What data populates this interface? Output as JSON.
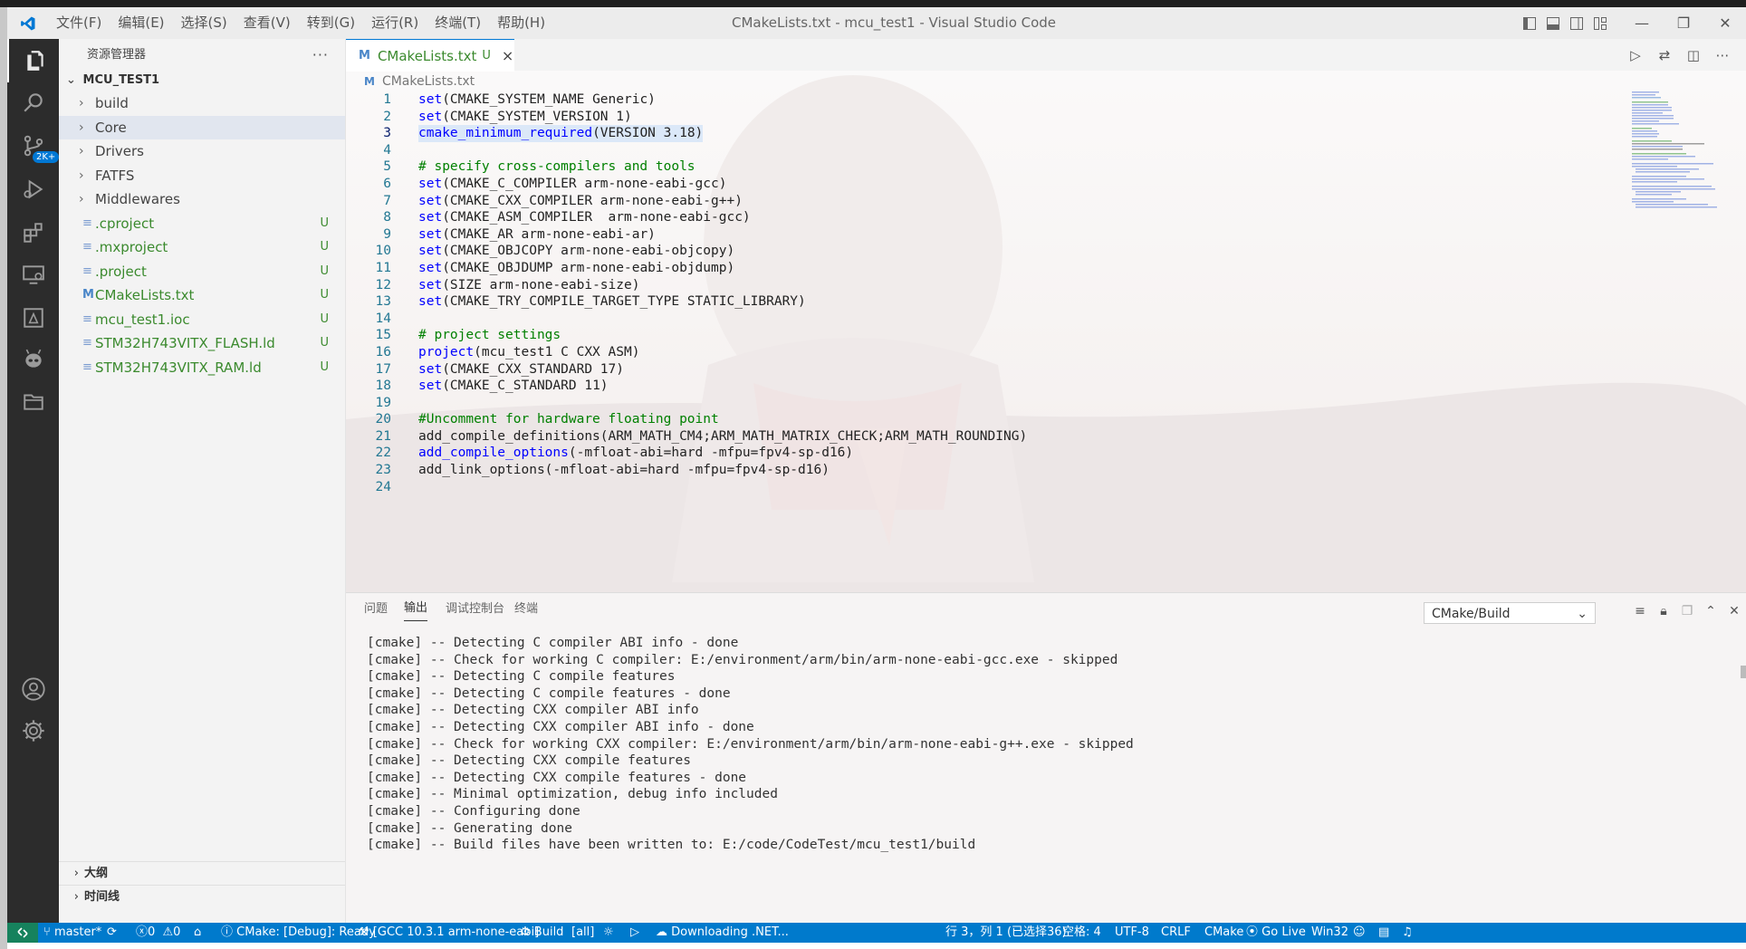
{
  "window": {
    "title": "CMakeLists.txt - mcu_test1 - Visual Studio Code",
    "menu": [
      "文件(F)",
      "编辑(E)",
      "选择(S)",
      "查看(V)",
      "转到(G)",
      "运行(R)",
      "终端(T)",
      "帮助(H)"
    ]
  },
  "activity_bar": {
    "source_control_badge": "2K+"
  },
  "sidebar": {
    "title": "资源管理器",
    "more": "···",
    "root": "MCU_TEST1",
    "items": [
      {
        "label": "build",
        "type": "folder",
        "badge": ""
      },
      {
        "label": "Core",
        "type": "folder",
        "badge": ""
      },
      {
        "label": "Drivers",
        "type": "folder",
        "badge": ""
      },
      {
        "label": "FATFS",
        "type": "folder",
        "badge": ""
      },
      {
        "label": "Middlewares",
        "type": "folder",
        "badge": ""
      },
      {
        "label": ".cproject",
        "type": "file",
        "badge": "U"
      },
      {
        "label": ".mxproject",
        "type": "file",
        "badge": "U"
      },
      {
        "label": ".project",
        "type": "file",
        "badge": "U"
      },
      {
        "label": "CMakeLists.txt",
        "type": "file",
        "badge": "U"
      },
      {
        "label": "mcu_test1.ioc",
        "type": "file",
        "badge": "U"
      },
      {
        "label": "STM32H743VITX_FLASH.ld",
        "type": "file",
        "badge": "U"
      },
      {
        "label": "STM32H743VITX_RAM.ld",
        "type": "file",
        "badge": "U"
      }
    ],
    "outline": "大纲",
    "timeline": "时间线"
  },
  "editor": {
    "tab": {
      "icon": "M",
      "name": "CMakeLists.txt",
      "status": "U",
      "close": "×"
    },
    "breadcrumb": {
      "icon": "M",
      "file": "CMakeLists.txt"
    },
    "lines": [
      {
        "n": "1",
        "kw": "set",
        "rest": "(CMAKE_SYSTEM_NAME Generic)",
        "comment": ""
      },
      {
        "n": "2",
        "kw": "set",
        "rest": "(CMAKE_SYSTEM_VERSION 1)",
        "comment": ""
      },
      {
        "n": "3",
        "kw": "cmake_minimum_required",
        "rest": "(VERSION 3.18)",
        "comment": ""
      },
      {
        "n": "4",
        "kw": "",
        "rest": "",
        "comment": ""
      },
      {
        "n": "5",
        "kw": "",
        "rest": "",
        "comment": "# specify cross-compilers and tools"
      },
      {
        "n": "6",
        "kw": "set",
        "rest": "(CMAKE_C_COMPILER arm-none-eabi-gcc)",
        "comment": ""
      },
      {
        "n": "7",
        "kw": "set",
        "rest": "(CMAKE_CXX_COMPILER arm-none-eabi-g++)",
        "comment": ""
      },
      {
        "n": "8",
        "kw": "set",
        "rest": "(CMAKE_ASM_COMPILER  arm-none-eabi-gcc)",
        "comment": ""
      },
      {
        "n": "9",
        "kw": "set",
        "rest": "(CMAKE_AR arm-none-eabi-ar)",
        "comment": ""
      },
      {
        "n": "10",
        "kw": "set",
        "rest": "(CMAKE_OBJCOPY arm-none-eabi-objcopy)",
        "comment": ""
      },
      {
        "n": "11",
        "kw": "set",
        "rest": "(CMAKE_OBJDUMP arm-none-eabi-objdump)",
        "comment": ""
      },
      {
        "n": "12",
        "kw": "set",
        "rest": "(SIZE arm-none-eabi-size)",
        "comment": ""
      },
      {
        "n": "13",
        "kw": "set",
        "rest": "(CMAKE_TRY_COMPILE_TARGET_TYPE STATIC_LIBRARY)",
        "comment": ""
      },
      {
        "n": "14",
        "kw": "",
        "rest": "",
        "comment": ""
      },
      {
        "n": "15",
        "kw": "",
        "rest": "",
        "comment": "# project settings"
      },
      {
        "n": "16",
        "kw": "project",
        "rest": "(mcu_test1 C CXX ASM)",
        "comment": ""
      },
      {
        "n": "17",
        "kw": "set",
        "rest": "(CMAKE_CXX_STANDARD 17)",
        "comment": ""
      },
      {
        "n": "18",
        "kw": "set",
        "rest": "(CMAKE_C_STANDARD 11)",
        "comment": ""
      },
      {
        "n": "19",
        "kw": "",
        "rest": "",
        "comment": ""
      },
      {
        "n": "20",
        "kw": "",
        "rest": "",
        "comment": "#Uncomment for hardware floating point"
      },
      {
        "n": "21",
        "kw": "",
        "rest": "add_compile_definitions(ARM_MATH_CM4;ARM_MATH_MATRIX_CHECK;ARM_MATH_ROUNDING)",
        "comment": ""
      },
      {
        "n": "22",
        "kw": "add_compile_options",
        "rest": "(-mfloat-abi=hard -mfpu=fpv4-sp-d16)",
        "comment": ""
      },
      {
        "n": "23",
        "kw": "",
        "rest": "add_link_options(-mfloat-abi=hard -mfpu=fpv4-sp-d16)",
        "comment": ""
      },
      {
        "n": "24",
        "kw": "",
        "rest": "",
        "comment": ""
      }
    ]
  },
  "panel": {
    "tabs": [
      "问题",
      "输出",
      "调试控制台",
      "终端"
    ],
    "active_tab": "输出",
    "channel": "CMake/Build",
    "output": [
      "[cmake] -- Detecting C compiler ABI info - done",
      "[cmake] -- Check for working C compiler: E:/environment/arm/bin/arm-none-eabi-gcc.exe - skipped",
      "[cmake] -- Detecting C compile features",
      "[cmake] -- Detecting C compile features - done",
      "[cmake] -- Detecting CXX compiler ABI info",
      "[cmake] -- Detecting CXX compiler ABI info - done",
      "[cmake] -- Check for working CXX compiler: E:/environment/arm/bin/arm-none-eabi-g++.exe - skipped",
      "[cmake] -- Detecting CXX compile features",
      "[cmake] -- Detecting CXX compile features - done",
      "[cmake] -- Minimal optimization, debug info included",
      "[cmake] -- Configuring done",
      "[cmake] -- Generating done",
      "[cmake] -- Build files have been written to: E:/code/CodeTest/mcu_test1/build"
    ]
  },
  "statusbar": {
    "branch": "master*",
    "errors": "0",
    "warnings": "0",
    "cmake_status": "CMake: [Debug]: Ready",
    "kit": "[GCC 10.3.1 arm-none-eabi]",
    "build": "Build",
    "target": "[all]",
    "downloading": "Downloading .NET...",
    "position": "行 3，列 1 (已选择36)",
    "spaces": "空格: 4",
    "encoding": "UTF-8",
    "eol": "CRLF",
    "language": "CMake",
    "golive": "Go Live",
    "platform": "Win32"
  }
}
